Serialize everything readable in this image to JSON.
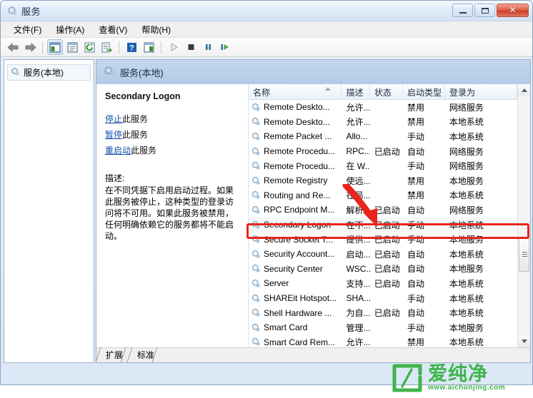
{
  "window": {
    "title": "服务",
    "title_icon": "services-gear-icon",
    "controls": {
      "minimize": "最小化",
      "maximize": "最大化",
      "close": "✕"
    }
  },
  "menubar": {
    "items": [
      {
        "label": "文件(F)",
        "name": "menu-file"
      },
      {
        "label": "操作(A)",
        "name": "menu-action"
      },
      {
        "label": "查看(V)",
        "name": "menu-view"
      },
      {
        "label": "帮助(H)",
        "name": "menu-help"
      }
    ]
  },
  "toolbar": {
    "buttons": [
      {
        "icon": "back-arrow-icon",
        "name": "toolbar-back"
      },
      {
        "icon": "forward-arrow-icon",
        "name": "toolbar-forward"
      },
      {
        "icon": "show-hide-tree-icon",
        "name": "toolbar-show-hide-tree",
        "pressed": true
      },
      {
        "icon": "properties-icon",
        "name": "toolbar-properties"
      },
      {
        "icon": "refresh-icon",
        "name": "toolbar-refresh"
      },
      {
        "icon": "export-list-icon",
        "name": "toolbar-export-list"
      },
      {
        "icon": "help-icon",
        "name": "toolbar-help"
      },
      {
        "icon": "show-action-pane-icon",
        "name": "toolbar-action-pane"
      },
      {
        "icon": "start-service-icon",
        "name": "toolbar-start-service"
      },
      {
        "icon": "stop-service-icon",
        "name": "toolbar-stop-service"
      },
      {
        "icon": "pause-service-icon",
        "name": "toolbar-pause-service"
      },
      {
        "icon": "restart-service-icon",
        "name": "toolbar-restart-service"
      }
    ]
  },
  "tree": {
    "root": {
      "label": "服务(本地)",
      "icon": "services-gear-icon"
    }
  },
  "right_pane": {
    "header": {
      "label": "服务(本地)",
      "icon": "services-gear-icon"
    }
  },
  "detail": {
    "service_name": "Secondary Logon",
    "links": [
      {
        "link_text": "停止",
        "tail_text": "此服务",
        "name": "stop-service-link"
      },
      {
        "link_text": "暂停",
        "tail_text": "此服务",
        "name": "pause-service-link"
      },
      {
        "link_text": "重启动",
        "tail_text": "此服务",
        "name": "restart-service-link"
      }
    ],
    "description_label": "描述:",
    "description_text": "在不同凭据下启用启动过程。如果此服务被停止，这种类型的登录访问将不可用。如果此服务被禁用，任何明确依赖它的服务都将不能启动。"
  },
  "list": {
    "columns": [
      {
        "label": "名称",
        "key": "name",
        "sorted": true
      },
      {
        "label": "描述",
        "key": "description"
      },
      {
        "label": "状态",
        "key": "status"
      },
      {
        "label": "启动类型",
        "key": "startup"
      },
      {
        "label": "登录为",
        "key": "logon"
      }
    ],
    "rows": [
      {
        "name": "Remote Deskto...",
        "description": "允许...",
        "status": "",
        "startup": "禁用",
        "logon": "网络服务",
        "selected": false
      },
      {
        "name": "Remote Deskto...",
        "description": "允许...",
        "status": "",
        "startup": "禁用",
        "logon": "本地系统",
        "selected": false
      },
      {
        "name": "Remote Packet ...",
        "description": "Allo...",
        "status": "",
        "startup": "手动",
        "logon": "本地系统",
        "selected": false
      },
      {
        "name": "Remote Procedu...",
        "description": "RPC...",
        "status": "已启动",
        "startup": "自动",
        "logon": "网络服务",
        "selected": false
      },
      {
        "name": "Remote Procedu...",
        "description": "在 W...",
        "status": "",
        "startup": "手动",
        "logon": "网络服务",
        "selected": false
      },
      {
        "name": "Remote Registry",
        "description": "使远...",
        "status": "",
        "startup": "禁用",
        "logon": "本地服务",
        "selected": false
      },
      {
        "name": "Routing and Re...",
        "description": "在局...",
        "status": "",
        "startup": "禁用",
        "logon": "本地系统",
        "selected": false
      },
      {
        "name": "RPC Endpoint M...",
        "description": "解析 ...",
        "status": "已启动",
        "startup": "自动",
        "logon": "网络服务",
        "selected": false
      },
      {
        "name": "Secondary Logon",
        "description": "在不...",
        "status": "已启动",
        "startup": "手动",
        "logon": "本地系统",
        "selected": true
      },
      {
        "name": "Secure Socket T...",
        "description": "提供...",
        "status": "已启动",
        "startup": "手动",
        "logon": "本地服务",
        "selected": false
      },
      {
        "name": "Security Account...",
        "description": "启动...",
        "status": "已启动",
        "startup": "自动",
        "logon": "本地系统",
        "selected": false
      },
      {
        "name": "Security Center",
        "description": "WSC...",
        "status": "已启动",
        "startup": "自动",
        "logon": "本地服务",
        "selected": false
      },
      {
        "name": "Server",
        "description": "支持...",
        "status": "已启动",
        "startup": "自动",
        "logon": "本地系统",
        "selected": false
      },
      {
        "name": "SHAREit Hotspot...",
        "description": "SHA...",
        "status": "",
        "startup": "手动",
        "logon": "本地系统",
        "selected": false
      },
      {
        "name": "Shell Hardware ...",
        "description": "为自...",
        "status": "已启动",
        "startup": "自动",
        "logon": "本地系统",
        "selected": false
      },
      {
        "name": "Smart Card",
        "description": "管理...",
        "status": "",
        "startup": "手动",
        "logon": "本地服务",
        "selected": false
      },
      {
        "name": "Smart Card Rem...",
        "description": "允许...",
        "status": "",
        "startup": "禁用",
        "logon": "本地系统",
        "selected": false
      }
    ]
  },
  "tabs": [
    {
      "label": "扩展",
      "name": "tab-extended",
      "active": false
    },
    {
      "label": "标准",
      "name": "tab-standard",
      "active": true
    }
  ],
  "watermark": {
    "brand_cn": "爱纯净",
    "url": "www.aichunjing.com",
    "color": "#3fb449"
  },
  "annotations": {
    "highlight_row_name": "Secondary Logon",
    "highlight_color": "#e8241c"
  }
}
